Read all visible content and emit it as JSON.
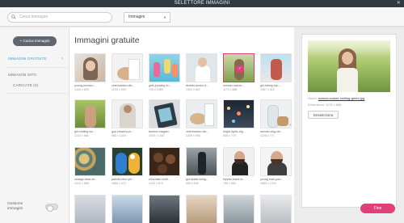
{
  "window": {
    "title": "SELETTORE IMMAGINI",
    "close": "✕"
  },
  "topbar": {
    "search_placeholder": "Cerca immagini",
    "select_value": "Immagini"
  },
  "sidebar": {
    "upload_label": "Carica immagini",
    "nav": [
      {
        "label": "IMMAGINI GRATUITE",
        "active": true
      },
      {
        "label": "IMMAGINI SITO",
        "active": false
      }
    ],
    "sub_item": "CARICATE (0)",
    "manage_label": "Gestione immagini"
  },
  "gallery": {
    "title": "Immagini gratuite",
    "thumbs": [
      {
        "cap": "young-woman-...",
        "dim": "1244 x 829"
      },
      {
        "cap": "veterinarian-clin...",
        "dim": "1200 x 900"
      },
      {
        "cap": "girls-jumping-fo...",
        "dim": "725 x 1089"
      },
      {
        "cap": "dentist-doctor-d...",
        "dim": "1302 x 822"
      },
      {
        "cap": "woman-nature-...",
        "dim": "1173 x 886"
      },
      {
        "cap": "girl-taking-trip-...",
        "dim": "1387 x 822"
      },
      {
        "cap": "girl-smiling-wo...",
        "dim": "1243 x 886"
      },
      {
        "cap": "guy-viewers-ph...",
        "dim": "964 x 1444"
      },
      {
        "cap": "fashion-magazi...",
        "dim": "2000 x 1267"
      },
      {
        "cap": "veterinarian-clin...",
        "dim": "1200 x 900"
      },
      {
        "cap": "bright-lights-nig...",
        "dim": "846 x 779"
      },
      {
        "cap": "woman-dog-vet...",
        "dim": "1198 x 777"
      },
      {
        "cap": "vintage-taxis-wr...",
        "dim": "1023 x 888"
      },
      {
        "cap": "parrots-blue-yel...",
        "dim": "1688 x 472"
      },
      {
        "cap": "chocolate-truffl...",
        "dim": "1223 x 879"
      },
      {
        "cap": "girl-skater-bridg...",
        "dim": "960 x 640"
      },
      {
        "cap": "hipster-black-w...",
        "dim": "788 x 960"
      },
      {
        "cap": "young-man-port...",
        "dim": "1680 x 1204"
      },
      {
        "cap": "",
        "dim": ""
      },
      {
        "cap": "",
        "dim": ""
      },
      {
        "cap": "",
        "dim": ""
      },
      {
        "cap": "",
        "dim": ""
      },
      {
        "cap": "",
        "dim": ""
      },
      {
        "cap": "",
        "dim": ""
      }
    ]
  },
  "panel": {
    "name_label": "Nome:",
    "name_value": "woman-nature-smiling-green.jpg",
    "dim_label": "Dimensioni:",
    "dim_value": "1173 x 886",
    "deselect_label": "Deseleziona"
  },
  "footer": {
    "confirm_label": "Fine"
  },
  "colors": {
    "accent": "#e0407a",
    "active_nav": "#3aa3d6",
    "titlebar": "#2f3a44"
  }
}
